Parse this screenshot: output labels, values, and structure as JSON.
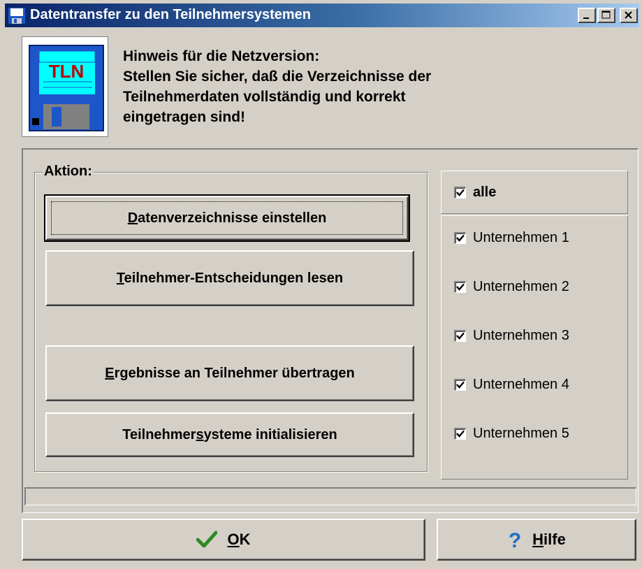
{
  "window": {
    "title": "Datentransfer zu den Teilnehmersystemen",
    "controls": [
      "minimize",
      "maximize",
      "close"
    ]
  },
  "hint": {
    "icon_text": "TLN",
    "lines": [
      "Hinweis für die Netzversion:",
      "Stellen Sie sicher, daß die Verzeichnisse der",
      "Teilnehmerdaten vollständig und korrekt",
      "eingetragen sind!"
    ]
  },
  "action_group": {
    "label": "Aktion:",
    "buttons": [
      {
        "pre": "",
        "accel": "D",
        "post": "atenverzeichnisse einstellen"
      },
      {
        "pre": "",
        "accel": "T",
        "post": "eilnehmer-Entscheidungen lesen"
      },
      {
        "pre": "",
        "accel": "E",
        "post": "rgebnisse an Teilnehmer übertragen"
      },
      {
        "pre": "Teilnehmer",
        "accel": "s",
        "post": "ysteme initialisieren"
      }
    ]
  },
  "checkboxes": {
    "all": {
      "label": "alle",
      "checked": true
    },
    "items": [
      {
        "label": "Unternehmen 1",
        "checked": true
      },
      {
        "label": "Unternehmen 2",
        "checked": true
      },
      {
        "label": "Unternehmen 3",
        "checked": true
      },
      {
        "label": "Unternehmen 4",
        "checked": true
      },
      {
        "label": "Unternehmen 5",
        "checked": true
      }
    ]
  },
  "progress": {
    "value": 0
  },
  "footer": {
    "ok": {
      "accel": "O",
      "post": "K",
      "icon": "checkmark-icon"
    },
    "help": {
      "accel": "H",
      "post": "ilfe",
      "icon": "question-mark-icon"
    }
  },
  "colors": {
    "titlebar_start": "#0a246a",
    "titlebar_end": "#a6caf0",
    "face": "#d4d0c8",
    "ok_check": "#2e8b20",
    "help_q": "#1e6ec8"
  }
}
